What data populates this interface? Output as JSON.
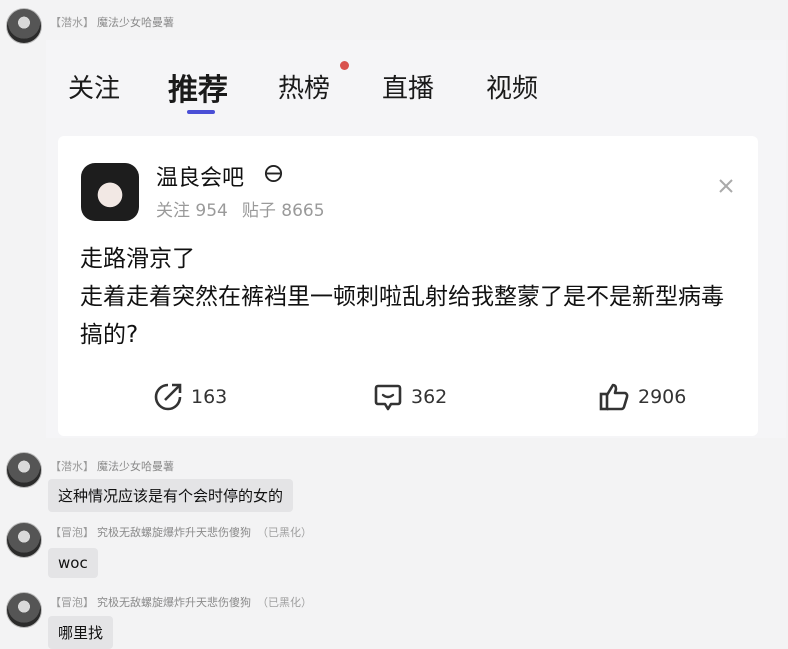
{
  "messages": [
    {
      "tag": "【潜水】",
      "sender": "魔法少女哈曼薯",
      "suffix": "",
      "text": ""
    },
    {
      "tag": "【潜水】",
      "sender": "魔法少女哈曼薯",
      "suffix": "",
      "text": "这种情况应该是有个会时停的女的"
    },
    {
      "tag": "【冒泡】",
      "sender": "究极无敌螺旋爆炸升天悲伤傻狗",
      "suffix": "（已黑化）",
      "text": "woc"
    },
    {
      "tag": "【冒泡】",
      "sender": "究极无敌螺旋爆炸升天悲伤傻狗",
      "suffix": "（已黑化）",
      "text": "哪里找"
    }
  ],
  "screenshot": {
    "tabs": [
      "关注",
      "推荐",
      "热榜",
      "直播",
      "视频"
    ],
    "active_tab": "推荐",
    "card": {
      "name": "温良会吧",
      "follow": "关注 954",
      "posts": "贴子 8665",
      "text_line1": "走路滑京了",
      "text_line2": "走着走着突然在裤裆里一顿刺啦乱射给我整蒙了是不是新型病毒搞的?",
      "share_count": "163",
      "comment_count": "362",
      "like_count": "2906"
    }
  },
  "icons": [
    "avatar",
    "no-entry-icon",
    "close-icon",
    "share-icon",
    "comment-icon",
    "like-icon"
  ],
  "colors": {
    "tab_underline": "#4a4fd6",
    "notification_dot": "#d9534f"
  }
}
